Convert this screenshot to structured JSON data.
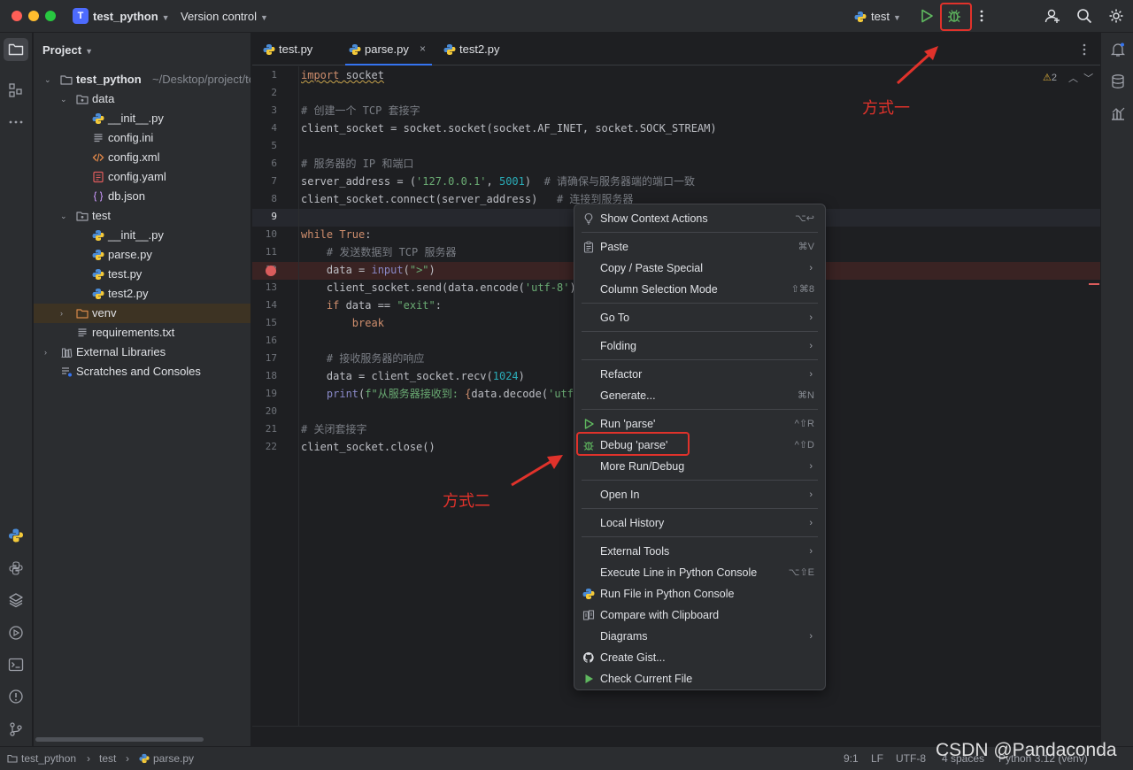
{
  "titlebar": {
    "project_badge": "T",
    "project_name": "test_python",
    "version_control": "Version control",
    "run_config": "test"
  },
  "project_panel": {
    "title": "Project",
    "tree": [
      {
        "label": "test_python",
        "hint": "~/Desktop/project/tes",
        "type": "folder",
        "level": 0,
        "expanded": true
      },
      {
        "label": "data",
        "type": "package",
        "level": 1,
        "expanded": true
      },
      {
        "label": "__init__.py",
        "type": "python",
        "level": 2
      },
      {
        "label": "config.ini",
        "type": "text",
        "level": 2
      },
      {
        "label": "config.xml",
        "type": "xml",
        "level": 2
      },
      {
        "label": "config.yaml",
        "type": "yaml",
        "level": 2
      },
      {
        "label": "db.json",
        "type": "json",
        "level": 2
      },
      {
        "label": "test",
        "type": "package",
        "level": 1,
        "expanded": true
      },
      {
        "label": "__init__.py",
        "type": "python",
        "level": 2
      },
      {
        "label": "parse.py",
        "type": "python",
        "level": 2
      },
      {
        "label": "test.py",
        "type": "python",
        "level": 2
      },
      {
        "label": "test2.py",
        "type": "python",
        "level": 2
      },
      {
        "label": "venv",
        "type": "folder-venv",
        "level": 1,
        "expanded": false,
        "selected": true
      },
      {
        "label": "requirements.txt",
        "type": "text",
        "level": 1
      },
      {
        "label": "External Libraries",
        "type": "libs",
        "level": 0,
        "expanded": false
      },
      {
        "label": "Scratches and Consoles",
        "type": "scratch",
        "level": 0
      }
    ]
  },
  "tabs": [
    {
      "label": "test.py",
      "active": false
    },
    {
      "label": "parse.py",
      "active": true,
      "close": "×"
    },
    {
      "label": "test2.py",
      "active": false
    }
  ],
  "editor": {
    "warning_count": "2",
    "line_numbers": [
      "1",
      "2",
      "3",
      "4",
      "5",
      "6",
      "7",
      "8",
      "9",
      "10",
      "11",
      "12",
      "13",
      "14",
      "15",
      "16",
      "17",
      "18",
      "19",
      "20",
      "21",
      "22"
    ]
  },
  "context_menu": {
    "items": [
      {
        "label": "Show Context Actions",
        "shortcut": "⌥↩",
        "icon": "bulb"
      },
      {
        "sep": true
      },
      {
        "label": "Paste",
        "shortcut": "⌘V",
        "icon": "clipboard"
      },
      {
        "label": "Copy / Paste Special",
        "submenu": true
      },
      {
        "label": "Column Selection Mode",
        "shortcut": "⇧⌘8"
      },
      {
        "sep": true
      },
      {
        "label": "Go To",
        "submenu": true
      },
      {
        "sep": true
      },
      {
        "label": "Folding",
        "submenu": true
      },
      {
        "sep": true
      },
      {
        "label": "Refactor",
        "submenu": true
      },
      {
        "label": "Generate...",
        "shortcut": "⌘N"
      },
      {
        "sep": true
      },
      {
        "label": "Run 'parse'",
        "shortcut": "^⇧R",
        "icon": "run"
      },
      {
        "label": "Debug 'parse'",
        "shortcut": "^⇧D",
        "icon": "debug"
      },
      {
        "label": "More Run/Debug",
        "submenu": true
      },
      {
        "sep": true
      },
      {
        "label": "Open In",
        "submenu": true
      },
      {
        "sep": true
      },
      {
        "label": "Local History",
        "submenu": true
      },
      {
        "sep": true
      },
      {
        "label": "External Tools",
        "submenu": true
      },
      {
        "label": "Execute Line in Python Console",
        "shortcut": "⌥⇧E"
      },
      {
        "label": "Run File in Python Console",
        "icon": "python"
      },
      {
        "label": "Compare with Clipboard",
        "icon": "compare"
      },
      {
        "label": "Diagrams",
        "submenu": true
      },
      {
        "label": "Create Gist...",
        "icon": "github"
      },
      {
        "label": "Check Current File",
        "icon": "check-run"
      }
    ]
  },
  "annotations": {
    "method_one": "方式一",
    "method_two": "方式二"
  },
  "statusbar": {
    "breadcrumb_project": "test_python",
    "breadcrumb_folder": "test",
    "breadcrumb_file": "parse.py",
    "position": "9:1",
    "line_sep": "LF",
    "encoding": "UTF-8",
    "indent": "4 spaces",
    "interpreter": "Python 3.12 (venv)"
  },
  "watermark": "CSDN @Pandaconda",
  "colors": {
    "accent": "#3574f0",
    "annotation_red": "#e0322b",
    "breakpoint": "#db5c5c",
    "run_green": "#5fb85f"
  }
}
